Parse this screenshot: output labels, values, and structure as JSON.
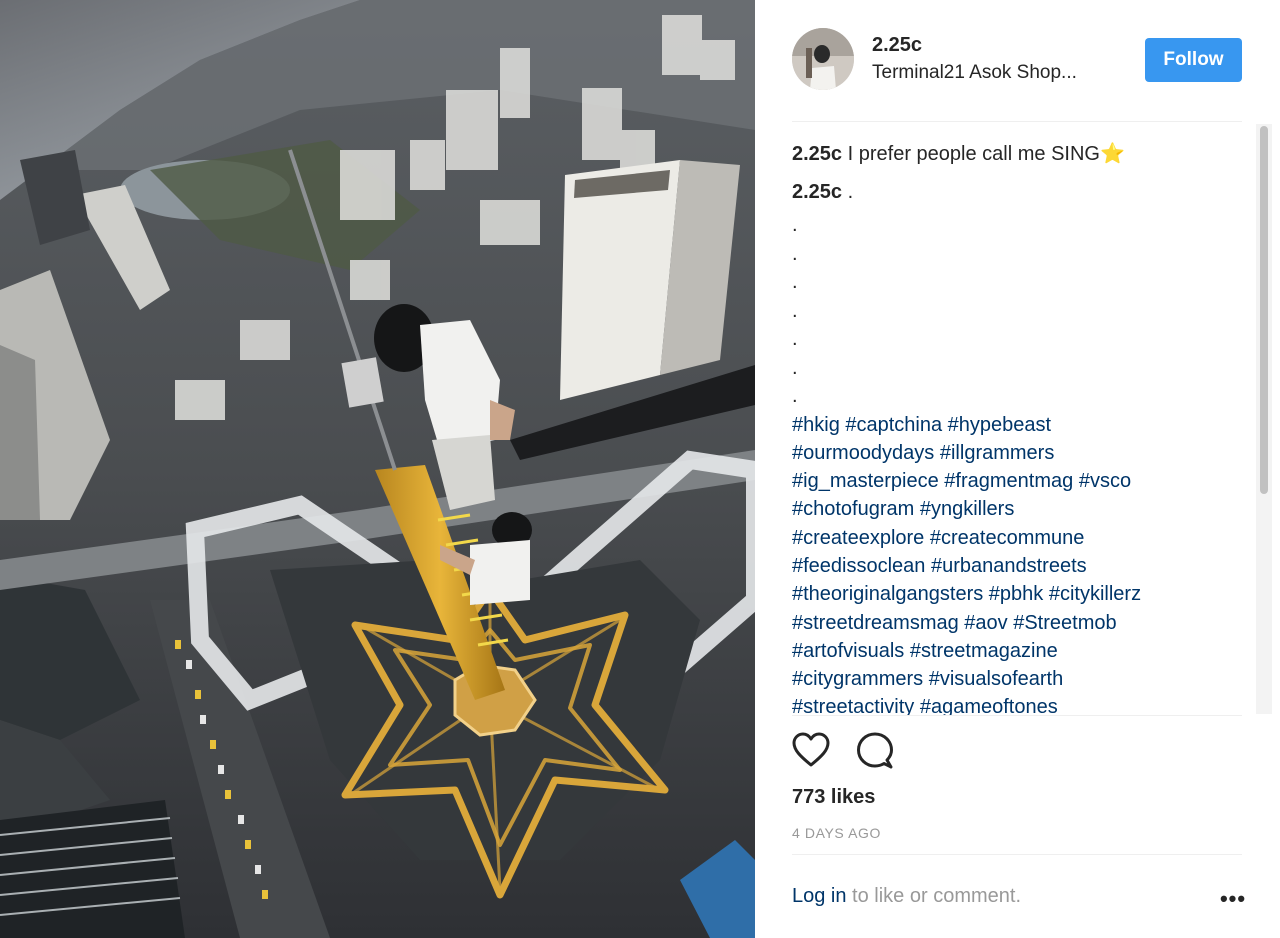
{
  "post": {
    "image_alt": "Aerial photo of two climbers on a spire above a city",
    "author": {
      "username": "2.25c",
      "location": "Terminal21 Asok Shop..."
    },
    "follow_label": "Follow",
    "caption": {
      "username": "2.25c",
      "text": "I prefer people call me SING",
      "star": "⭐"
    },
    "comment": {
      "username": "2.25c",
      "text": ".",
      "dot_lines": [
        ".",
        ".",
        ".",
        ".",
        ".",
        ".",
        "."
      ],
      "hashtag_lines": [
        "#hkig #captchina #hypebeast",
        "#ourmoodydays #illgrammers",
        "#ig_masterpiece #fragmentmag #vsco",
        "#chotofugram #yngkillers",
        "#createexplore #createcommune",
        "#feedissoclean #urbanandstreets",
        "#theoriginalgangsters #pbhk #citykillerz",
        "#streetdreamsmag #aov #Streetmob",
        "#artofvisuals #streetmagazine",
        "#citygrammers #visualsofearth",
        "#streetactivity #agameoftones"
      ]
    },
    "actions": {
      "like_icon": "heart-icon",
      "comment_icon": "comment-icon"
    },
    "likes": "773 likes",
    "timestamp": "4 DAYS AGO",
    "login": {
      "link": "Log in",
      "rest": " to like or comment."
    },
    "more_label": "•••"
  },
  "colors": {
    "follow_bg": "#3897f0",
    "hashtag": "#003569",
    "muted": "#999999"
  }
}
